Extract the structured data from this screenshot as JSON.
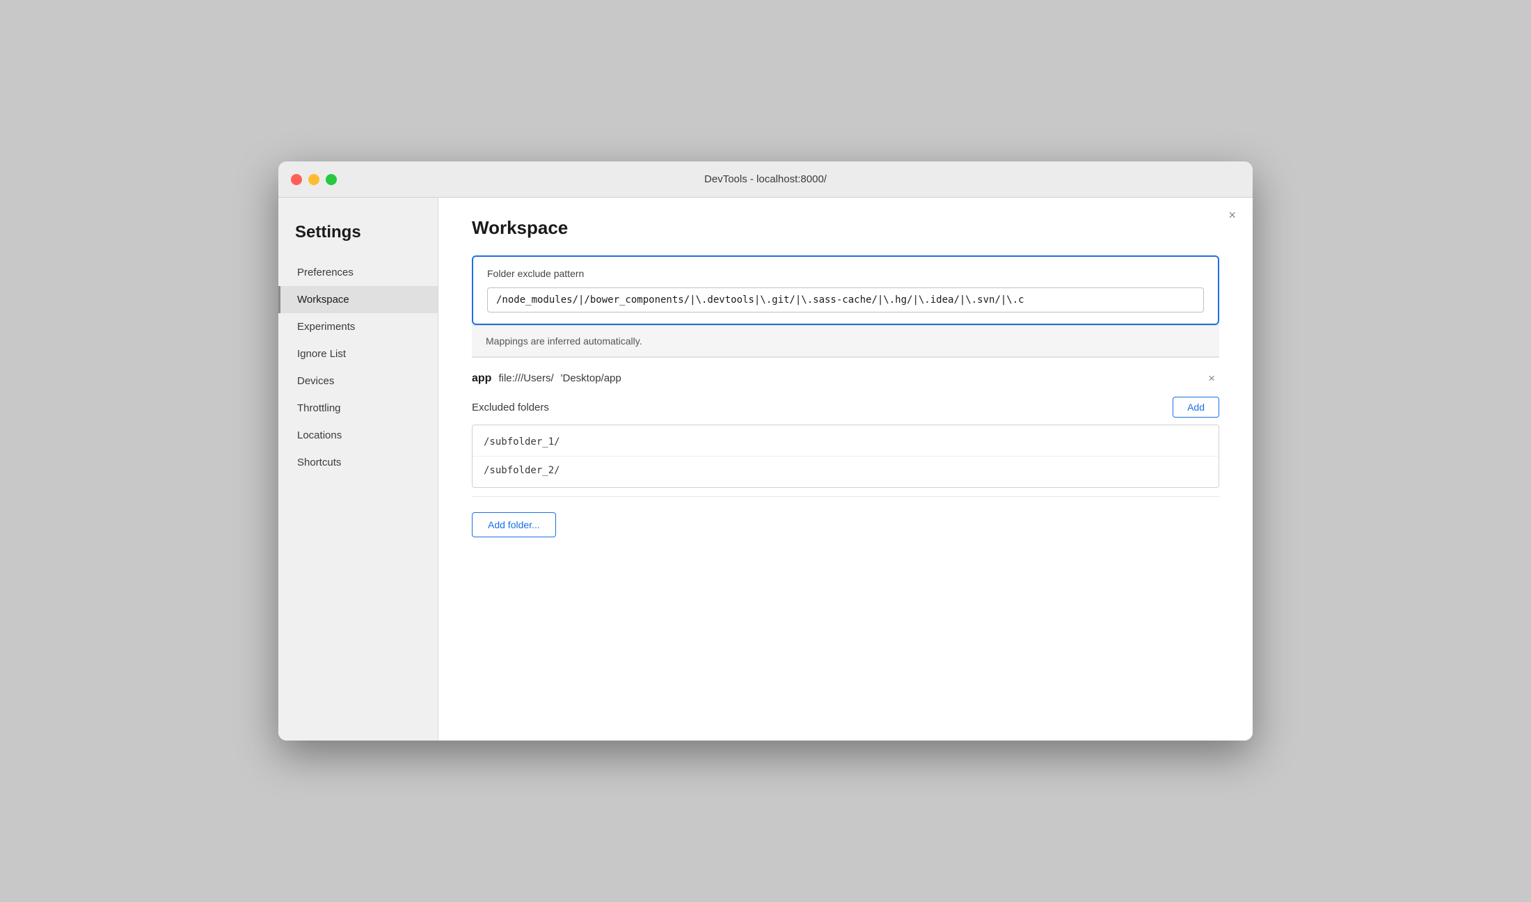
{
  "titlebar": {
    "title": "DevTools - localhost:8000/"
  },
  "sidebar": {
    "heading": "Settings",
    "items": [
      {
        "id": "preferences",
        "label": "Preferences",
        "active": false
      },
      {
        "id": "workspace",
        "label": "Workspace",
        "active": true
      },
      {
        "id": "experiments",
        "label": "Experiments",
        "active": false
      },
      {
        "id": "ignore-list",
        "label": "Ignore List",
        "active": false
      },
      {
        "id": "devices",
        "label": "Devices",
        "active": false
      },
      {
        "id": "throttling",
        "label": "Throttling",
        "active": false
      },
      {
        "id": "locations",
        "label": "Locations",
        "active": false
      },
      {
        "id": "shortcuts",
        "label": "Shortcuts",
        "active": false
      }
    ]
  },
  "main": {
    "page_title": "Workspace",
    "close_label": "×",
    "folder_exclude": {
      "label": "Folder exclude pattern",
      "value": "/node_modules/|/bower_components/|\\.devtools|\\.git/|\\.sass-cache/|\\.hg/|\\.idea/|\\.svn/|\\.c"
    },
    "info_text": "Mappings are inferred automatically.",
    "folder_entry": {
      "name": "app",
      "path": "file:///Users/",
      "path2": "'Desktop/app"
    },
    "excluded_folders": {
      "label": "Excluded folders",
      "add_label": "Add",
      "items": [
        "/subfolder_1/",
        "/subfolder_2/"
      ]
    },
    "add_folder_label": "Add folder..."
  }
}
